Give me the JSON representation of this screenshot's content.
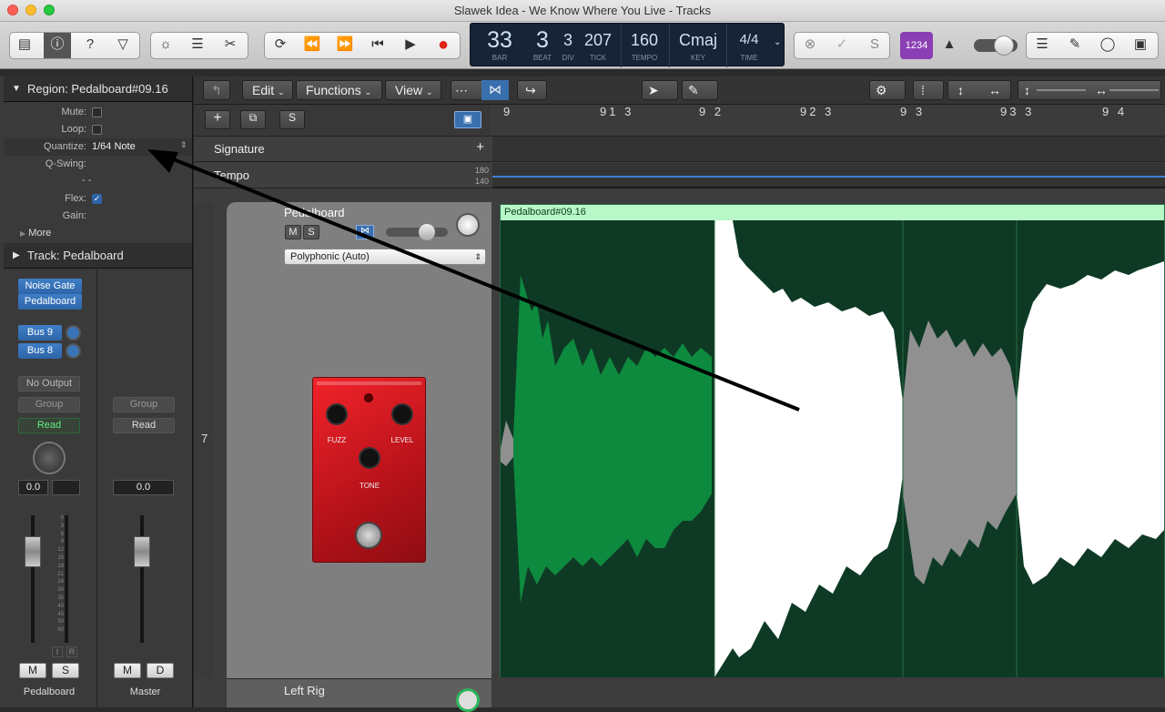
{
  "window": {
    "title": "Slawek Idea - We Know Where You Live - Tracks"
  },
  "lcd": {
    "bar": "33",
    "beat": "3",
    "div": "3",
    "tick": "207",
    "tempo": "160",
    "key": "Cmaj",
    "time": "4/4",
    "bar_label": "BAR",
    "beat_label": "BEAT",
    "div_label": "DIV",
    "tick_label": "TICK",
    "tempo_label": "TEMPO",
    "key_label": "KEY",
    "time_label": "TIME"
  },
  "toolbar": {
    "cpu_label": "1234"
  },
  "region_inspector": {
    "title": "Region: Pedalboard#09.16",
    "mute": "Mute:",
    "loop": "Loop:",
    "quantize": "Quantize:",
    "quantize_value": "1/64 Note",
    "qswing": "Q-Swing:",
    "dash": "- -",
    "flex": "Flex:",
    "gain": "Gain:",
    "more": "More"
  },
  "track_inspector": {
    "title": "Track:  Pedalboard"
  },
  "strip": {
    "plugins": [
      "Noise Gate",
      "Pedalboard"
    ],
    "bus1": "Bus 9",
    "bus2": "Bus 8",
    "output": "No Output",
    "group": "Group",
    "read": "Read",
    "vol": "0.0",
    "m": "M",
    "s": "S",
    "i": "I",
    "r": "R",
    "name": "Pedalboard",
    "scale": [
      "0",
      "3",
      "6",
      "9",
      "12",
      "15",
      "18",
      "21",
      "24",
      "30",
      "35",
      "40",
      "45",
      "50",
      "60"
    ]
  },
  "master": {
    "group": "Group",
    "read": "Read",
    "vol": "0.0",
    "m": "M",
    "d": "D",
    "name": "Master"
  },
  "menus": {
    "edit": "Edit",
    "functions": "Functions",
    "view": "View"
  },
  "header_buttons": {
    "add": "+",
    "s": "S"
  },
  "global_tracks": {
    "signature": "Signature",
    "tempo": "Tempo",
    "tempo_hi": "180",
    "tempo_lo": "140",
    "plus": "+"
  },
  "ruler": [
    "9",
    "91 3",
    "9 2",
    "92 3",
    "9 3",
    "93 3",
    "9 4"
  ],
  "track": {
    "number": "7",
    "name": "Pedalboard",
    "m": "M",
    "s": "S",
    "mode": "Polyphonic (Auto)",
    "next_track": "Left Rig"
  },
  "pedal": {
    "fuzz": "FUZZ",
    "level": "LEVEL",
    "tone": "TONE"
  },
  "region": {
    "name": "Pedalboard#09.16"
  },
  "colors": {
    "lcd_bg": "#172436",
    "region_header": "#b8f7c7",
    "waveform_selected": "#0e8a3e",
    "plugin_blue": "#2d64a8",
    "pedal_red": "#d9181f",
    "cpu_purple": "#8a3fb5"
  }
}
